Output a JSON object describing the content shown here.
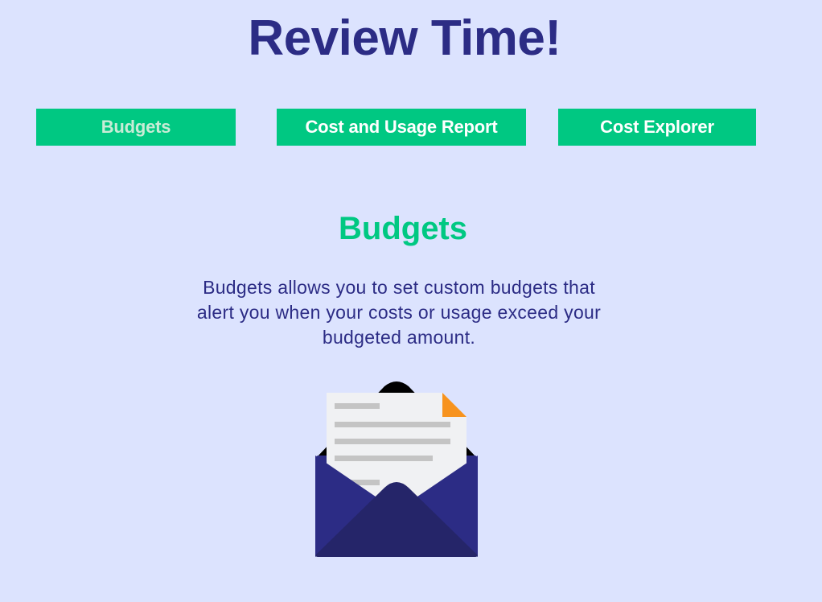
{
  "page": {
    "title": "Review Time!"
  },
  "tabs": [
    {
      "label": "Budgets",
      "active": true
    },
    {
      "label": "Cost and Usage Report",
      "active": false
    },
    {
      "label": "Cost Explorer",
      "active": false
    }
  ],
  "content": {
    "heading": "Budgets",
    "description": "Budgets allows you to set custom budgets that alert you when your costs or usage exceed your budgeted amount.",
    "illustration_icon": "open-envelope-with-letter-icon"
  },
  "colors": {
    "background": "#dce3fe",
    "title": "#2c2c85",
    "accent_green": "#00c882",
    "envelope_navy": "#2c2c85",
    "paper_corner_orange": "#f7931e"
  }
}
